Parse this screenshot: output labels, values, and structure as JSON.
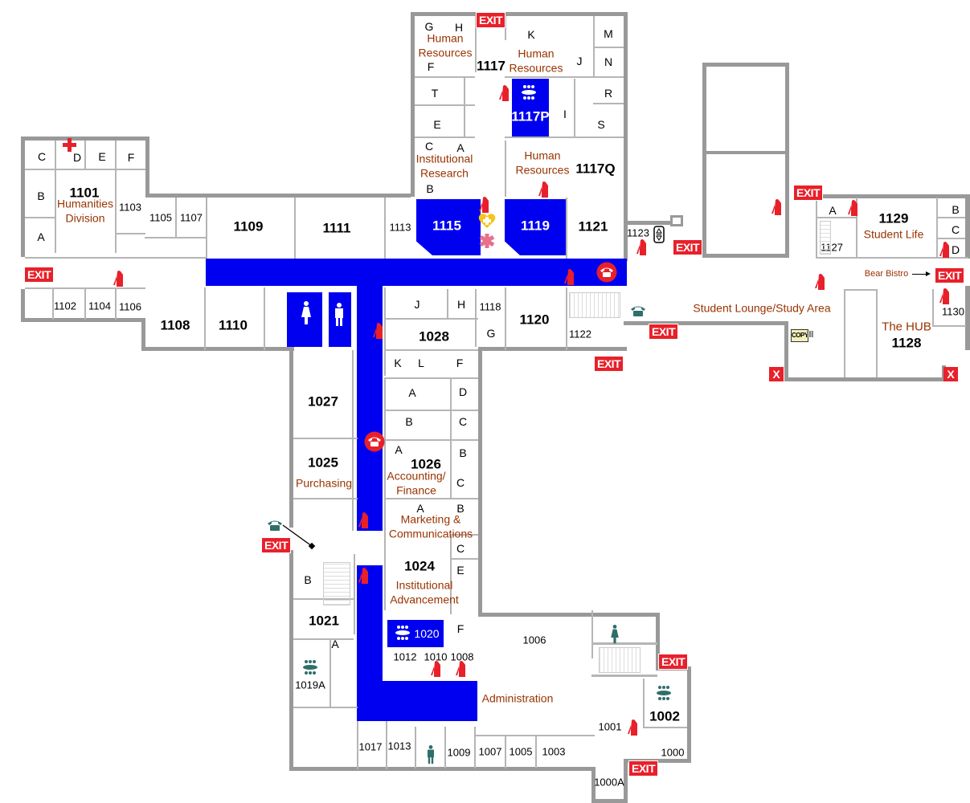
{
  "map": {
    "exit_label": "EXIT",
    "x_label": "X",
    "colors": {
      "corridor": "#0000f0",
      "wall": "#999999",
      "department_text": "#993300",
      "exit_sign": "#e8202a",
      "fire_extinguisher": "#e8202a",
      "phone_teal": "#2f6f6a",
      "aed_yellow": "#f5c518"
    },
    "departments": {
      "humanities": "Humanities Division",
      "hr": "Human Resources",
      "ir": "Institutional Research",
      "student_life": "Student Life",
      "lounge": "Student Lounge/Study Area",
      "bistro": "Bear Bistro",
      "hub": "The HUB",
      "purchasing": "Purchasing",
      "accounting": "Accounting/ Finance",
      "marketing": "Marketing & Communications",
      "advancement": "Institutional Advancement",
      "administration": "Administration"
    },
    "rooms": {
      "r1101": "1101",
      "r1102": "1102",
      "r1103": "1103",
      "r1104": "1104",
      "r1105": "1105",
      "r1106": "1106",
      "r1107": "1107",
      "r1108": "1108",
      "r1109": "1109",
      "r1110": "1110",
      "r1111": "1111",
      "r1113": "1113",
      "r1115": "1115",
      "r1117": "1117",
      "r1117P": "1117P",
      "r1117Q": "1117Q",
      "r1118": "1118",
      "r1119": "1119",
      "r1120": "1120",
      "r1121": "1121",
      "r1122": "1122",
      "r1123": "1123",
      "r1127": "1127",
      "r1128": "1128",
      "r1129": "1129",
      "r1130": "1130",
      "r1028": "1028",
      "r1027": "1027",
      "r1026": "1026",
      "r1025": "1025",
      "r1024": "1024",
      "r1021": "1021",
      "r1020": "1020",
      "r1019A": "1019A",
      "r1017": "1017",
      "r1013": "1013",
      "r1012": "1012",
      "r1010": "1010",
      "r1009": "1009",
      "r1008": "1008",
      "r1007": "1007",
      "r1006": "1006",
      "r1005": "1005",
      "r1003": "1003",
      "r1002": "1002",
      "r1001": "1001",
      "r1000": "1000",
      "r1000A": "1000A"
    },
    "letters": {
      "A": "A",
      "B": "B",
      "C": "C",
      "D": "D",
      "E": "E",
      "F": "F",
      "G": "G",
      "H": "H",
      "I": "I",
      "J": "J",
      "K": "K",
      "L": "L",
      "M": "M",
      "N": "N",
      "R": "R",
      "S": "S",
      "T": "T"
    },
    "copy_label": "COPY"
  }
}
